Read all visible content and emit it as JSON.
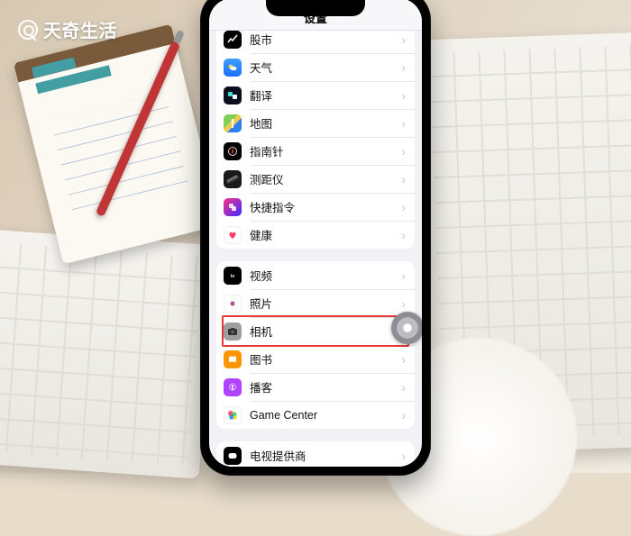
{
  "watermark": "天奇生活",
  "header": {
    "title": "设置"
  },
  "groups": [
    {
      "id": "g1",
      "rows": [
        {
          "key": "stocks",
          "label": "股市",
          "icon": "stocks-icon"
        },
        {
          "key": "weather",
          "label": "天气",
          "icon": "weather-icon"
        },
        {
          "key": "translate",
          "label": "翻译",
          "icon": "translate-icon"
        },
        {
          "key": "maps",
          "label": "地图",
          "icon": "maps-icon"
        },
        {
          "key": "compass",
          "label": "指南针",
          "icon": "compass-icon"
        },
        {
          "key": "measure",
          "label": "测距仪",
          "icon": "measure-icon"
        },
        {
          "key": "shortcuts",
          "label": "快捷指令",
          "icon": "shortcuts-icon"
        },
        {
          "key": "health",
          "label": "健康",
          "icon": "health-icon"
        }
      ]
    },
    {
      "id": "g2",
      "rows": [
        {
          "key": "tv",
          "label": "视频",
          "icon": "tv-icon"
        },
        {
          "key": "photos",
          "label": "照片",
          "icon": "photos-icon"
        },
        {
          "key": "camera",
          "label": "相机",
          "icon": "camera-icon",
          "highlighted": true
        },
        {
          "key": "books",
          "label": "图书",
          "icon": "books-icon"
        },
        {
          "key": "podcasts",
          "label": "播客",
          "icon": "podcasts-icon"
        },
        {
          "key": "gamecenter",
          "label": "Game Center",
          "icon": "gamecenter-icon"
        }
      ]
    },
    {
      "id": "g3",
      "rows": [
        {
          "key": "tvprovider",
          "label": "电视提供商",
          "icon": "tvprovider-icon"
        }
      ]
    }
  ],
  "assistive_touch_visible": true
}
